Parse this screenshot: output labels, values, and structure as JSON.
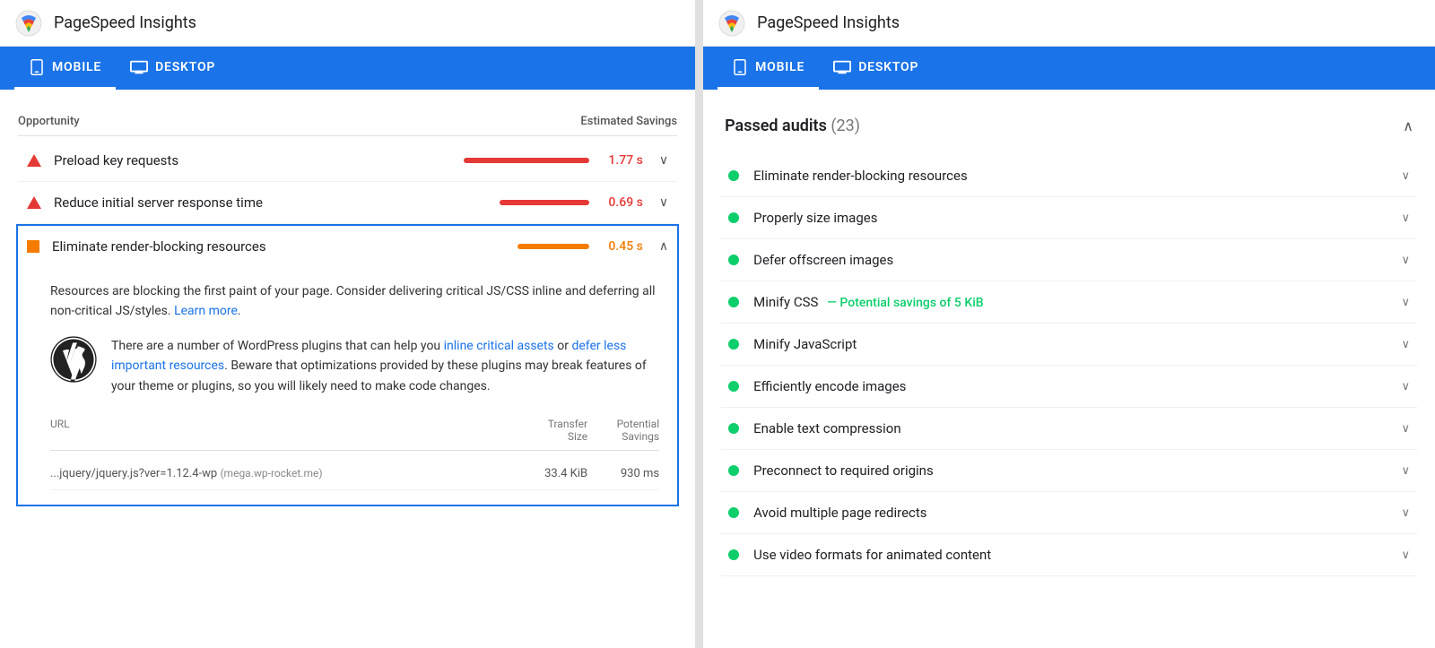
{
  "left_panel": {
    "app_title": "PageSpeed Insights",
    "tabs": [
      {
        "label": "MOBILE",
        "active": true
      },
      {
        "label": "DESKTOP",
        "active": false
      }
    ],
    "section_header": {
      "opportunity": "Opportunity",
      "estimated_savings": "Estimated Savings"
    },
    "audit_items": [
      {
        "id": "preload",
        "icon": "warning",
        "label": "Preload key requests",
        "savings": "1.77 s",
        "bar_color": "red",
        "expanded": false
      },
      {
        "id": "server-response",
        "icon": "warning",
        "label": "Reduce initial server response time",
        "savings": "0.69 s",
        "bar_color": "red",
        "expanded": false
      },
      {
        "id": "render-blocking",
        "icon": "orange",
        "label": "Eliminate render-blocking resources",
        "savings": "0.45 s",
        "bar_color": "orange",
        "expanded": true
      }
    ],
    "expanded_content": {
      "description": "Resources are blocking the first paint of your page. Consider delivering critical JS/CSS inline and deferring all non-critical JS/styles.",
      "learn_more_text": "Learn more",
      "wp_text_1": "There are a number of WordPress plugins that can help you ",
      "inline_link": "inline critical assets",
      "wp_text_2": " or ",
      "defer_link": "defer less important resources",
      "wp_text_3": ". Beware that optimizations provided by these plugins may break features of your theme or plugins, so you will likely need to make code changes.",
      "table": {
        "url_header": "URL",
        "transfer_size_header": "Transfer Size",
        "potential_savings_header": "Potential Savings",
        "rows": [
          {
            "url": "...jquery/jquery.js?ver=1.12.4-wp",
            "source": "(mega.wp-rocket.me)",
            "transfer_size": "33.4 KiB",
            "potential_savings": "930 ms"
          }
        ]
      }
    }
  },
  "right_panel": {
    "app_title": "PageSpeed Insights",
    "tabs": [
      {
        "label": "MOBILE",
        "active": true
      },
      {
        "label": "DESKTOP",
        "active": false
      }
    ],
    "passed_audits": {
      "title": "Passed audits",
      "count": "(23)",
      "items": [
        {
          "label": "Eliminate render-blocking resources",
          "savings_tag": null
        },
        {
          "label": "Properly size images",
          "savings_tag": null
        },
        {
          "label": "Defer offscreen images",
          "savings_tag": null
        },
        {
          "label": "Minify CSS",
          "savings_tag": "— Potential savings of 5 KiB"
        },
        {
          "label": "Minify JavaScript",
          "savings_tag": null
        },
        {
          "label": "Efficiently encode images",
          "savings_tag": null
        },
        {
          "label": "Enable text compression",
          "savings_tag": null
        },
        {
          "label": "Preconnect to required origins",
          "savings_tag": null
        },
        {
          "label": "Avoid multiple page redirects",
          "savings_tag": null
        },
        {
          "label": "Use video formats for animated content",
          "savings_tag": null
        }
      ]
    }
  }
}
